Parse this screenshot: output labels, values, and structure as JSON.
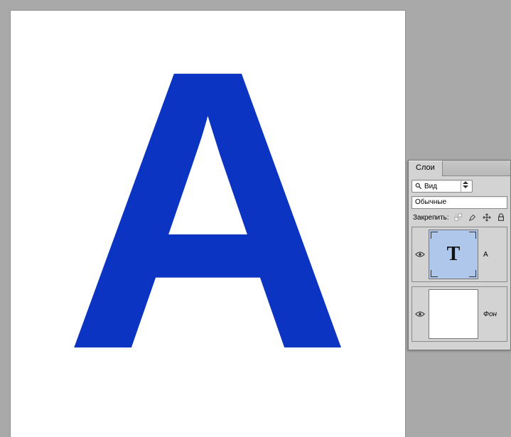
{
  "canvas": {
    "letter": "А"
  },
  "panel": {
    "tab_label": "Слои",
    "filter_label": "Вид",
    "mode_label": "Обычные",
    "lock_label": "Закрепить:"
  },
  "layers": [
    {
      "name": "A",
      "type": "text",
      "selected": true,
      "thumb_letter": "T"
    },
    {
      "name": "Фон",
      "type": "background",
      "selected": false
    }
  ]
}
